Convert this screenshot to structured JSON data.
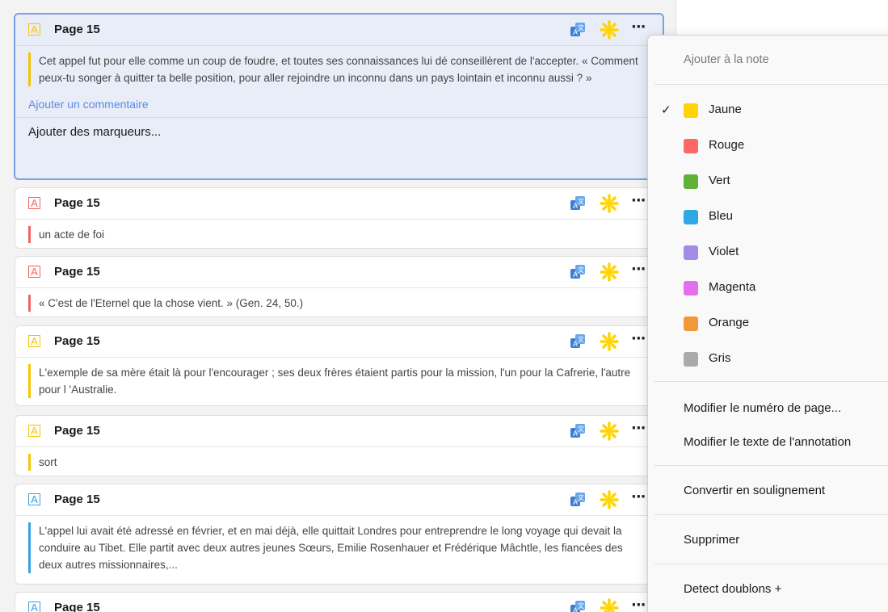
{
  "cards": [
    {
      "title": "Page 15",
      "color": "#f5c400",
      "text": "Cet appel fut pour elle comme un coup de foudre, et toutes ses connaissances lui dé conseillèrent de l'accepter. « Comment peux-tu songer à quitter ta belle position, pour aller rejoindre un inconnu dans un pays lointain et inconnu aussi ? »",
      "comment_placeholder": "Ajouter un commentaire",
      "tags_label": "Ajouter des marqueurs..."
    },
    {
      "title": "Page 15",
      "color": "#f06464",
      "text": "un acte de foi"
    },
    {
      "title": "Page 15",
      "color": "#f06464",
      "text": "« C'est de l'Eternel que la chose vient. » (Gen. 24, 50.)"
    },
    {
      "title": "Page 15",
      "color": "#f5c400",
      "text": "L'exemple de sa mère était là pour l'encourager ; ses deux frères étaient partis pour la mission, l'un pour la Cafrerie, l'autre pour l 'Australie."
    },
    {
      "title": "Page 15",
      "color": "#f5c400",
      "text": "sort"
    },
    {
      "title": "Page 15",
      "color": "#3aa0e0",
      "text": "L'appel lui avait été adressé en février, et en mai déjà, elle quittait Londres pour entreprendre le long voyage qui devait la conduire au Tibet. Elle partit avec deux autres jeunes Sœurs, Emilie Rosenhauer et Frédérique Mâchtle, les fiancées des deux autres missionnaires,..."
    },
    {
      "title": "Page 15",
      "color": "#3aa0e0",
      "text": ""
    }
  ],
  "card_icons": {
    "translate": "translate-icon",
    "star": "sparkle-icon",
    "more": "···"
  },
  "menu": {
    "header": "Ajouter à la note",
    "check_mark": "✓",
    "colors": [
      {
        "label": "Jaune",
        "hex": "#ffd400",
        "checked": true
      },
      {
        "label": "Rouge",
        "hex": "#ff6666"
      },
      {
        "label": "Vert",
        "hex": "#5fb236"
      },
      {
        "label": "Bleu",
        "hex": "#2ea8e5"
      },
      {
        "label": "Violet",
        "hex": "#a28ae5"
      },
      {
        "label": "Magenta",
        "hex": "#e56eee"
      },
      {
        "label": "Orange",
        "hex": "#f19837"
      },
      {
        "label": "Gris",
        "hex": "#aaaaaa"
      }
    ],
    "edit_page": "Modifier le numéro de page...",
    "edit_text": "Modifier le texte de l'annotation",
    "convert": "Convertir en soulignement",
    "delete": "Supprimer",
    "detect": "Detect doublons +"
  }
}
